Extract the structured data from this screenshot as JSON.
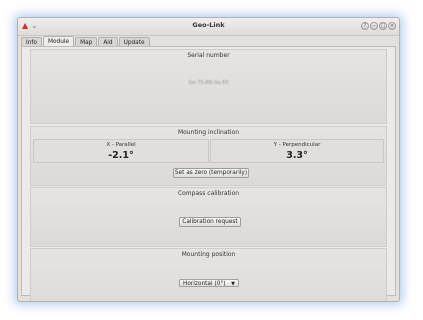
{
  "window": {
    "title": "Geo-Link"
  },
  "tabs": [
    {
      "label": "Info"
    },
    {
      "label": "Module"
    },
    {
      "label": "Map"
    },
    {
      "label": "Aid"
    },
    {
      "label": "Update"
    }
  ],
  "serial": {
    "title": "Serial number",
    "value": "Ge-7S-8N-9a-E0"
  },
  "mounting_inclination": {
    "title": "Mounting inclination",
    "x_label": "X - Parallel",
    "x_value": "-2.1°",
    "y_label": "Y - Perpendicular",
    "y_value": "3.3°",
    "zero_button": "Set as zero (temporarily)"
  },
  "compass": {
    "title": "Compass calibration",
    "button": "Calibration request"
  },
  "mounting_position": {
    "title": "Mounting position",
    "selected": "Horizontal (0°)"
  }
}
